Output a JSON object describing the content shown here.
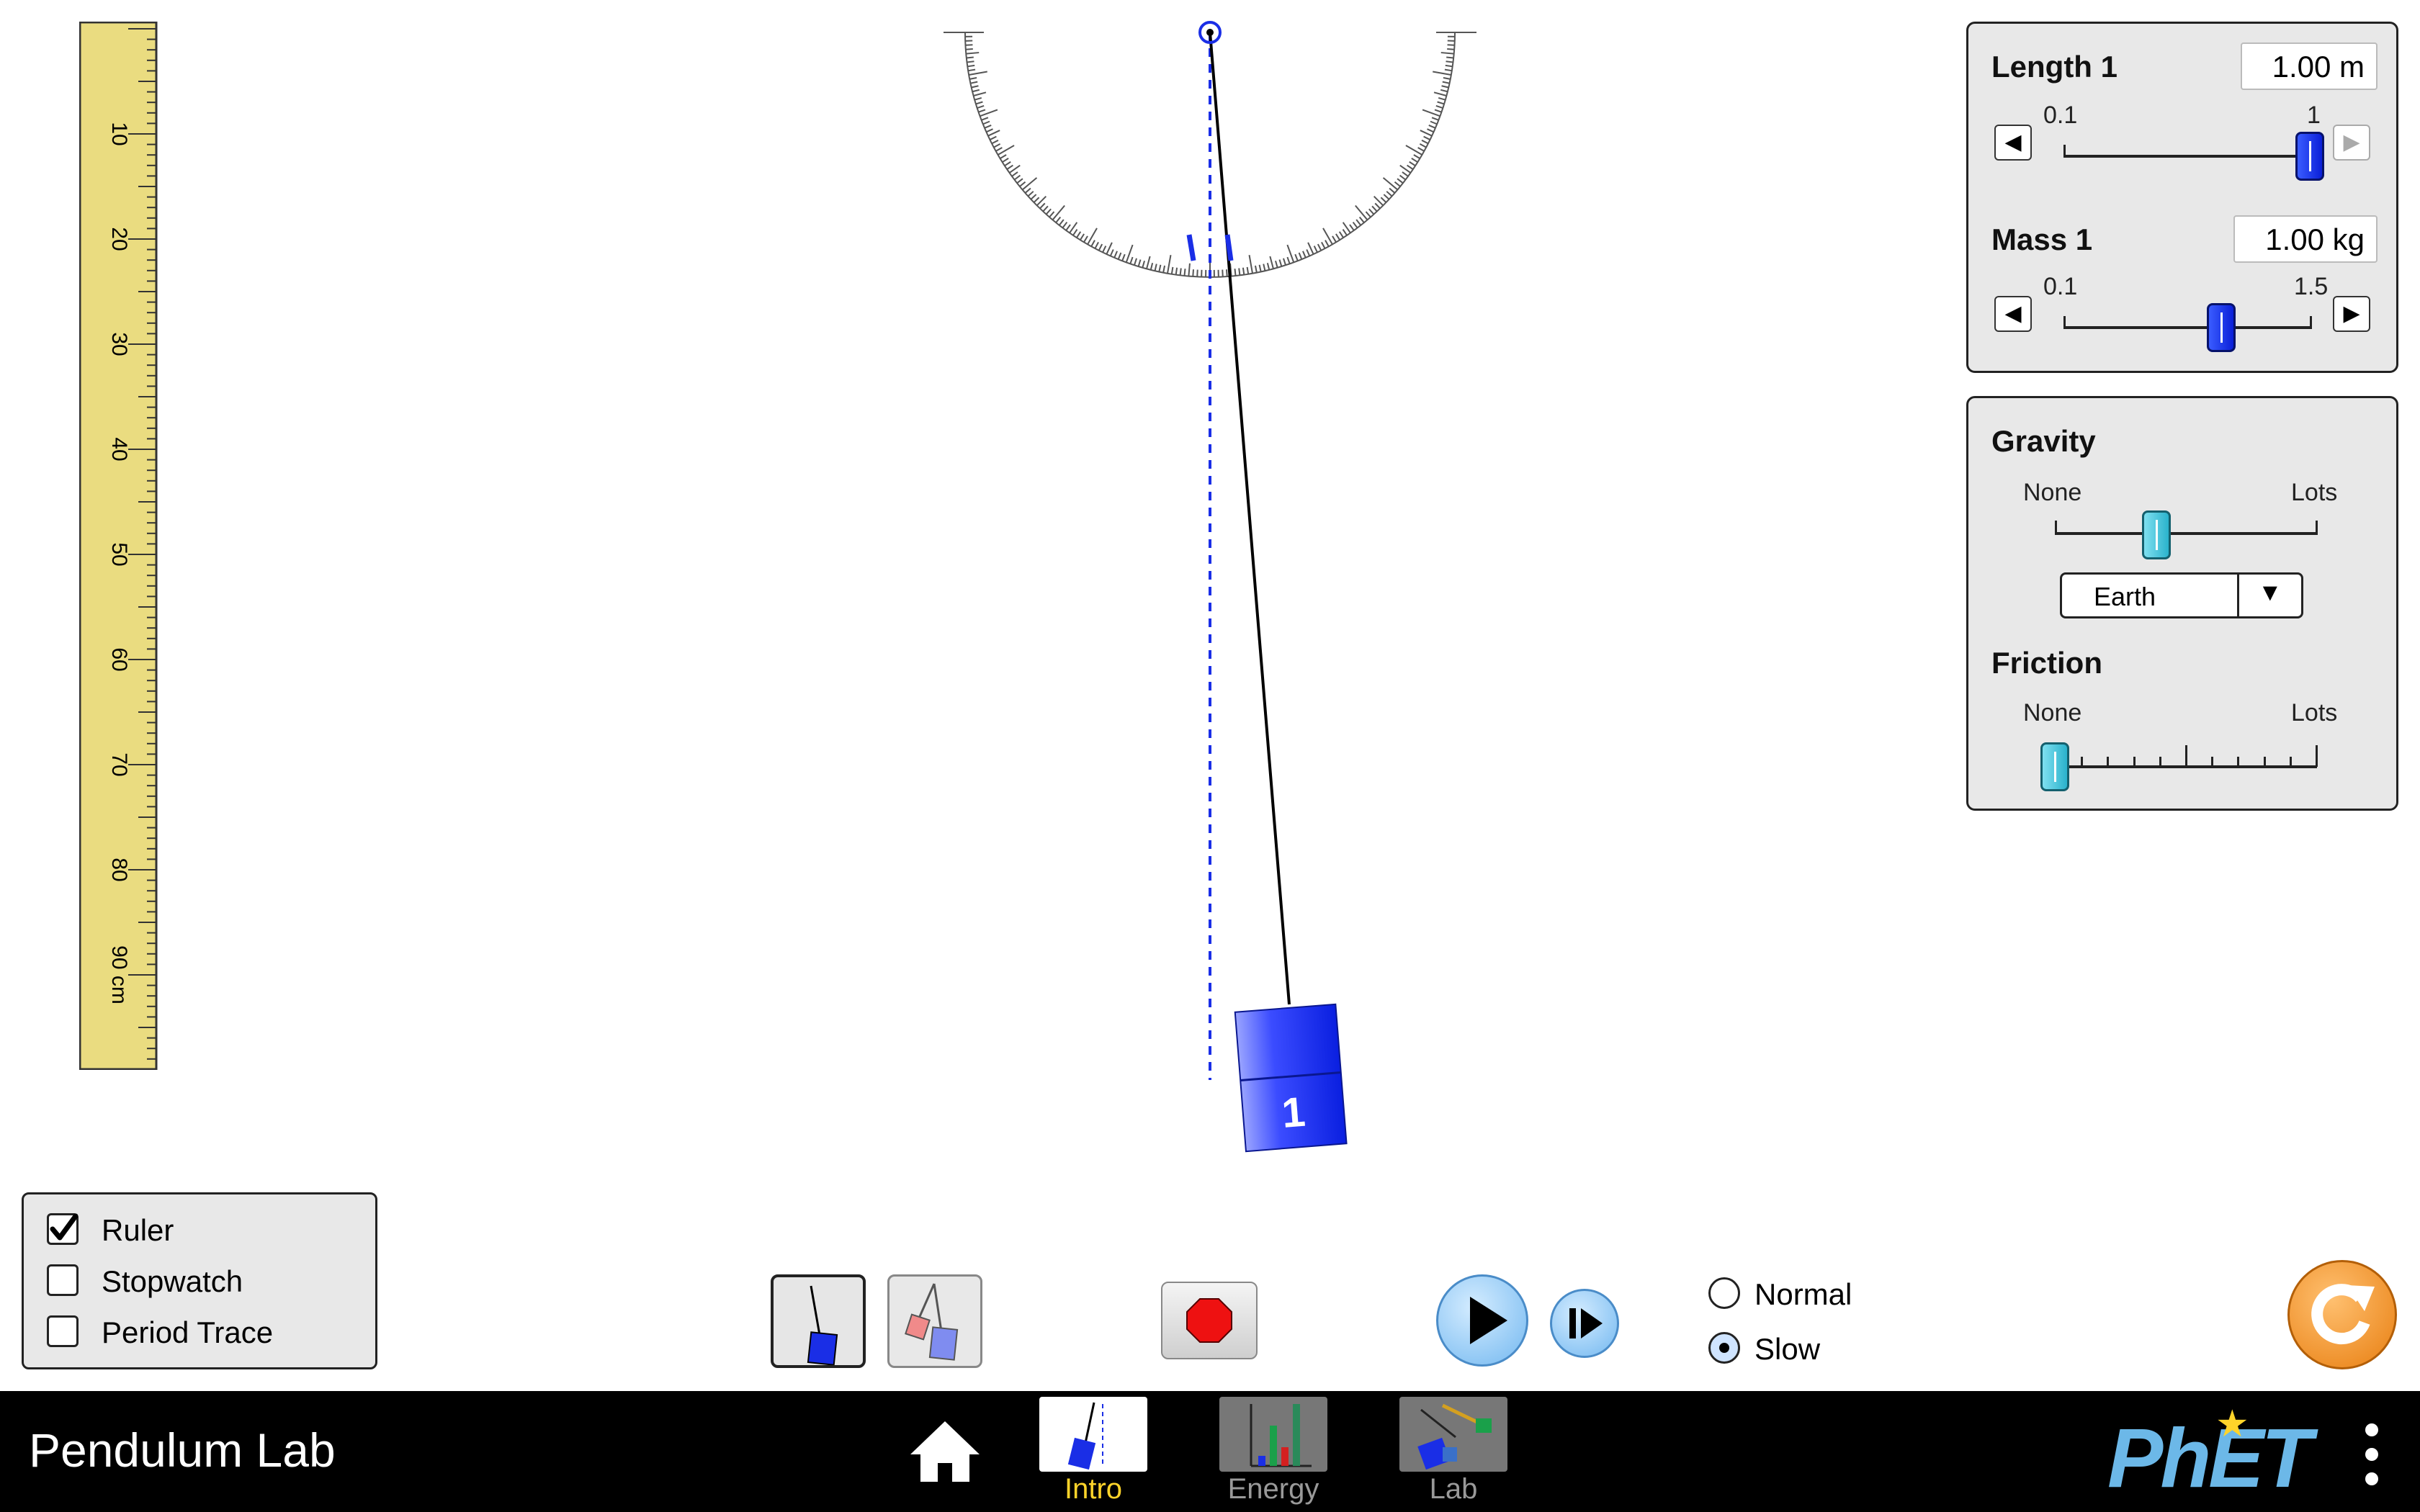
{
  "app": {
    "title": "Pendulum Lab",
    "brand": "PhET"
  },
  "ruler": {
    "tick_labels": [
      "10",
      "20",
      "30",
      "40",
      "50",
      "60",
      "70",
      "80",
      "90 cm"
    ]
  },
  "pendulum": {
    "mass_label": "1"
  },
  "length_panel": {
    "title": "Length 1",
    "value": "1.00 m",
    "min_label": "0.1",
    "max_label": "1",
    "value_fraction": 1.0
  },
  "mass_panel": {
    "title": "Mass 1",
    "value": "1.00 kg",
    "min_label": "0.1",
    "max_label": "1.5",
    "value_fraction": 0.64
  },
  "gravity_panel": {
    "title": "Gravity",
    "min_label": "None",
    "max_label": "Lots",
    "selected_body": "Earth",
    "value_fraction": 0.39
  },
  "friction_panel": {
    "title": "Friction",
    "min_label": "None",
    "max_label": "Lots",
    "value_fraction": 0.0
  },
  "tools": {
    "items": [
      {
        "label": "Ruler",
        "checked": true
      },
      {
        "label": "Stopwatch",
        "checked": false
      },
      {
        "label": "Period Trace",
        "checked": false
      }
    ]
  },
  "speed": {
    "options": [
      {
        "label": "Normal",
        "selected": false
      },
      {
        "label": "Slow",
        "selected": true
      }
    ]
  },
  "nav": {
    "tabs": [
      {
        "label": "Intro",
        "selected": true
      },
      {
        "label": "Energy",
        "selected": false
      },
      {
        "label": "Lab",
        "selected": false
      }
    ]
  },
  "colors": {
    "accent_yellow": "#ffd42a",
    "slider_blue": "#1a2ee6",
    "slider_cyan": "#55c9de",
    "ruler": "#eadc80",
    "reset_orange": "#f08a24",
    "play_blue": "#8ec9f5",
    "phet_blue": "#6cb8e8"
  }
}
